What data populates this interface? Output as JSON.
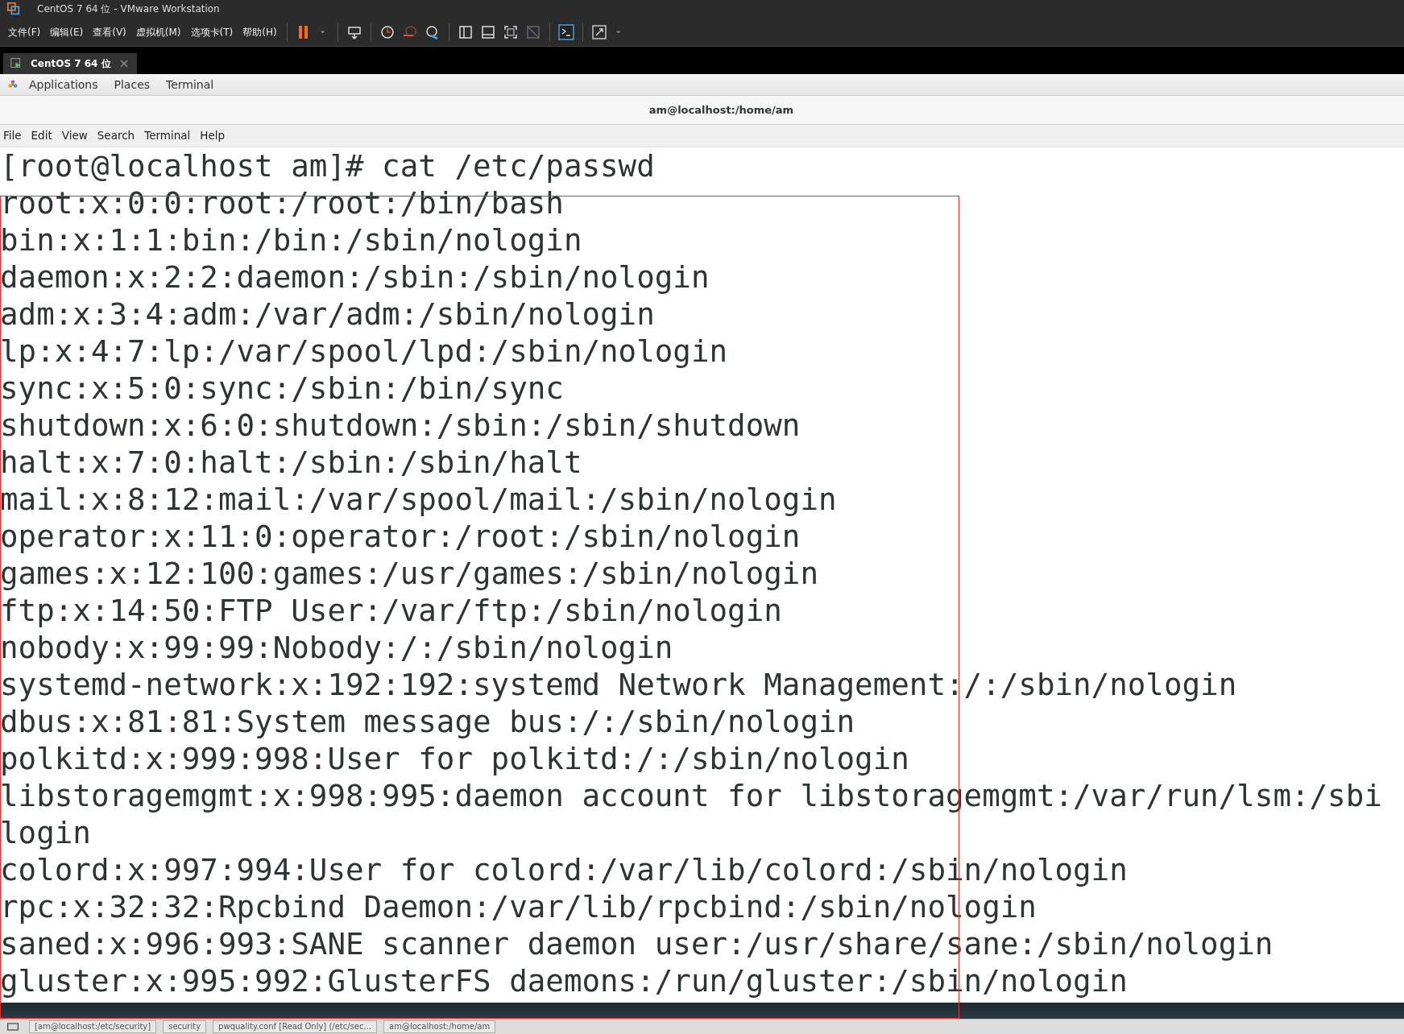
{
  "window": {
    "title": "CentOS 7 64 位 - VMware Workstation"
  },
  "menu": [
    "文件(F)",
    "编辑(E)",
    "查看(V)",
    "虚拟机(M)",
    "选项卡(T)",
    "帮助(H)"
  ],
  "tab": {
    "label": "CentOS 7 64 位"
  },
  "gnome_bar": [
    "Applications",
    "Places",
    "Terminal"
  ],
  "terminal": {
    "title": "am@localhost:/home/am",
    "menu": [
      "File",
      "Edit",
      "View",
      "Search",
      "Terminal",
      "Help"
    ],
    "lines": [
      "[root@localhost am]# cat /etc/passwd",
      "root:x:0:0:root:/root:/bin/bash",
      "bin:x:1:1:bin:/bin:/sbin/nologin",
      "daemon:x:2:2:daemon:/sbin:/sbin/nologin",
      "adm:x:3:4:adm:/var/adm:/sbin/nologin",
      "lp:x:4:7:lp:/var/spool/lpd:/sbin/nologin",
      "sync:x:5:0:sync:/sbin:/bin/sync",
      "shutdown:x:6:0:shutdown:/sbin:/sbin/shutdown",
      "halt:x:7:0:halt:/sbin:/sbin/halt",
      "mail:x:8:12:mail:/var/spool/mail:/sbin/nologin",
      "operator:x:11:0:operator:/root:/sbin/nologin",
      "games:x:12:100:games:/usr/games:/sbin/nologin",
      "ftp:x:14:50:FTP User:/var/ftp:/sbin/nologin",
      "nobody:x:99:99:Nobody:/:/sbin/nologin",
      "systemd-network:x:192:192:systemd Network Management:/:/sbin/nologin",
      "dbus:x:81:81:System message bus:/:/sbin/nologin",
      "polkitd:x:999:998:User for polkitd:/:/sbin/nologin",
      "libstoragemgmt:x:998:995:daemon account for libstoragemgmt:/var/run/lsm:/sbi",
      "login",
      "colord:x:997:994:User for colord:/var/lib/colord:/sbin/nologin",
      "rpc:x:32:32:Rpcbind Daemon:/var/lib/rpcbind:/sbin/nologin",
      "saned:x:996:993:SANE scanner daemon user:/usr/share/sane:/sbin/nologin",
      "gluster:x:995:992:GlusterFS daemons:/run/gluster:/sbin/nologin"
    ]
  },
  "taskbar": [
    "[am@localhost:/etc/security]",
    "security",
    "pwquality.conf [Read Only] (/etc/sec...",
    "am@localhost:/home/am"
  ]
}
